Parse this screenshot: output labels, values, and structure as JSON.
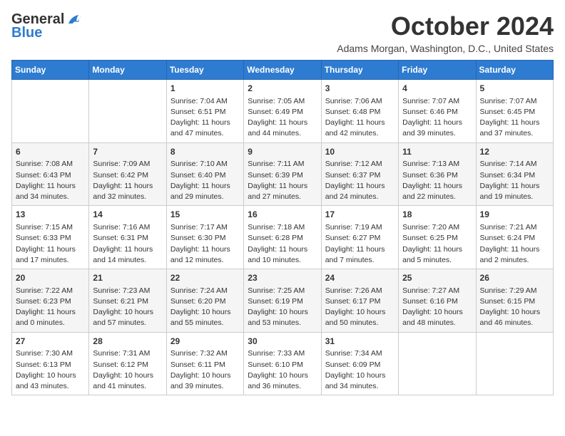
{
  "header": {
    "logo_line1": "General",
    "logo_line2": "Blue",
    "month_title": "October 2024",
    "subtitle": "Adams Morgan, Washington, D.C., United States"
  },
  "days_of_week": [
    "Sunday",
    "Monday",
    "Tuesday",
    "Wednesday",
    "Thursday",
    "Friday",
    "Saturday"
  ],
  "weeks": [
    [
      null,
      null,
      {
        "day": 1,
        "sunrise": "Sunrise: 7:04 AM",
        "sunset": "Sunset: 6:51 PM",
        "daylight": "Daylight: 11 hours and 47 minutes."
      },
      {
        "day": 2,
        "sunrise": "Sunrise: 7:05 AM",
        "sunset": "Sunset: 6:49 PM",
        "daylight": "Daylight: 11 hours and 44 minutes."
      },
      {
        "day": 3,
        "sunrise": "Sunrise: 7:06 AM",
        "sunset": "Sunset: 6:48 PM",
        "daylight": "Daylight: 11 hours and 42 minutes."
      },
      {
        "day": 4,
        "sunrise": "Sunrise: 7:07 AM",
        "sunset": "Sunset: 6:46 PM",
        "daylight": "Daylight: 11 hours and 39 minutes."
      },
      {
        "day": 5,
        "sunrise": "Sunrise: 7:07 AM",
        "sunset": "Sunset: 6:45 PM",
        "daylight": "Daylight: 11 hours and 37 minutes."
      }
    ],
    [
      {
        "day": 6,
        "sunrise": "Sunrise: 7:08 AM",
        "sunset": "Sunset: 6:43 PM",
        "daylight": "Daylight: 11 hours and 34 minutes."
      },
      {
        "day": 7,
        "sunrise": "Sunrise: 7:09 AM",
        "sunset": "Sunset: 6:42 PM",
        "daylight": "Daylight: 11 hours and 32 minutes."
      },
      {
        "day": 8,
        "sunrise": "Sunrise: 7:10 AM",
        "sunset": "Sunset: 6:40 PM",
        "daylight": "Daylight: 11 hours and 29 minutes."
      },
      {
        "day": 9,
        "sunrise": "Sunrise: 7:11 AM",
        "sunset": "Sunset: 6:39 PM",
        "daylight": "Daylight: 11 hours and 27 minutes."
      },
      {
        "day": 10,
        "sunrise": "Sunrise: 7:12 AM",
        "sunset": "Sunset: 6:37 PM",
        "daylight": "Daylight: 11 hours and 24 minutes."
      },
      {
        "day": 11,
        "sunrise": "Sunrise: 7:13 AM",
        "sunset": "Sunset: 6:36 PM",
        "daylight": "Daylight: 11 hours and 22 minutes."
      },
      {
        "day": 12,
        "sunrise": "Sunrise: 7:14 AM",
        "sunset": "Sunset: 6:34 PM",
        "daylight": "Daylight: 11 hours and 19 minutes."
      }
    ],
    [
      {
        "day": 13,
        "sunrise": "Sunrise: 7:15 AM",
        "sunset": "Sunset: 6:33 PM",
        "daylight": "Daylight: 11 hours and 17 minutes."
      },
      {
        "day": 14,
        "sunrise": "Sunrise: 7:16 AM",
        "sunset": "Sunset: 6:31 PM",
        "daylight": "Daylight: 11 hours and 14 minutes."
      },
      {
        "day": 15,
        "sunrise": "Sunrise: 7:17 AM",
        "sunset": "Sunset: 6:30 PM",
        "daylight": "Daylight: 11 hours and 12 minutes."
      },
      {
        "day": 16,
        "sunrise": "Sunrise: 7:18 AM",
        "sunset": "Sunset: 6:28 PM",
        "daylight": "Daylight: 11 hours and 10 minutes."
      },
      {
        "day": 17,
        "sunrise": "Sunrise: 7:19 AM",
        "sunset": "Sunset: 6:27 PM",
        "daylight": "Daylight: 11 hours and 7 minutes."
      },
      {
        "day": 18,
        "sunrise": "Sunrise: 7:20 AM",
        "sunset": "Sunset: 6:25 PM",
        "daylight": "Daylight: 11 hours and 5 minutes."
      },
      {
        "day": 19,
        "sunrise": "Sunrise: 7:21 AM",
        "sunset": "Sunset: 6:24 PM",
        "daylight": "Daylight: 11 hours and 2 minutes."
      }
    ],
    [
      {
        "day": 20,
        "sunrise": "Sunrise: 7:22 AM",
        "sunset": "Sunset: 6:23 PM",
        "daylight": "Daylight: 11 hours and 0 minutes."
      },
      {
        "day": 21,
        "sunrise": "Sunrise: 7:23 AM",
        "sunset": "Sunset: 6:21 PM",
        "daylight": "Daylight: 10 hours and 57 minutes."
      },
      {
        "day": 22,
        "sunrise": "Sunrise: 7:24 AM",
        "sunset": "Sunset: 6:20 PM",
        "daylight": "Daylight: 10 hours and 55 minutes."
      },
      {
        "day": 23,
        "sunrise": "Sunrise: 7:25 AM",
        "sunset": "Sunset: 6:19 PM",
        "daylight": "Daylight: 10 hours and 53 minutes."
      },
      {
        "day": 24,
        "sunrise": "Sunrise: 7:26 AM",
        "sunset": "Sunset: 6:17 PM",
        "daylight": "Daylight: 10 hours and 50 minutes."
      },
      {
        "day": 25,
        "sunrise": "Sunrise: 7:27 AM",
        "sunset": "Sunset: 6:16 PM",
        "daylight": "Daylight: 10 hours and 48 minutes."
      },
      {
        "day": 26,
        "sunrise": "Sunrise: 7:29 AM",
        "sunset": "Sunset: 6:15 PM",
        "daylight": "Daylight: 10 hours and 46 minutes."
      }
    ],
    [
      {
        "day": 27,
        "sunrise": "Sunrise: 7:30 AM",
        "sunset": "Sunset: 6:13 PM",
        "daylight": "Daylight: 10 hours and 43 minutes."
      },
      {
        "day": 28,
        "sunrise": "Sunrise: 7:31 AM",
        "sunset": "Sunset: 6:12 PM",
        "daylight": "Daylight: 10 hours and 41 minutes."
      },
      {
        "day": 29,
        "sunrise": "Sunrise: 7:32 AM",
        "sunset": "Sunset: 6:11 PM",
        "daylight": "Daylight: 10 hours and 39 minutes."
      },
      {
        "day": 30,
        "sunrise": "Sunrise: 7:33 AM",
        "sunset": "Sunset: 6:10 PM",
        "daylight": "Daylight: 10 hours and 36 minutes."
      },
      {
        "day": 31,
        "sunrise": "Sunrise: 7:34 AM",
        "sunset": "Sunset: 6:09 PM",
        "daylight": "Daylight: 10 hours and 34 minutes."
      },
      null,
      null
    ]
  ]
}
